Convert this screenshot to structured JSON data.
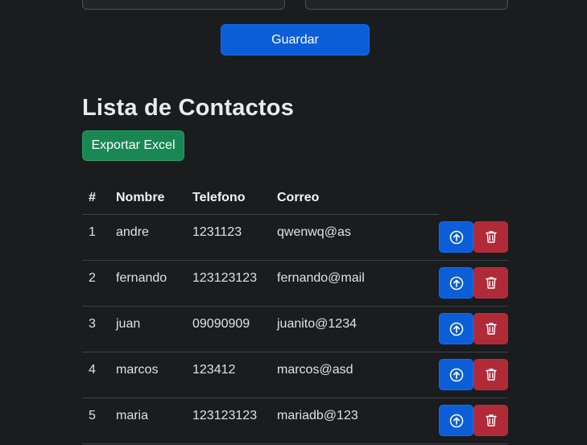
{
  "form": {
    "save_label": "Guardar"
  },
  "contacts": {
    "title": "Lista de Contactos",
    "export_label": "Exportar Excel",
    "columns": {
      "num": "#",
      "name": "Nombre",
      "phone": "Telefono",
      "email": "Correo"
    },
    "rows": [
      {
        "num": "1",
        "name": "andre",
        "phone": "1231123",
        "email": "qwenwq@as"
      },
      {
        "num": "2",
        "name": "fernando",
        "phone": "123123123",
        "email": "fernando@mail"
      },
      {
        "num": "3",
        "name": "juan",
        "phone": "09090909",
        "email": "juanito@1234"
      },
      {
        "num": "4",
        "name": "marcos",
        "phone": "123412",
        "email": "marcos@asd"
      },
      {
        "num": "5",
        "name": "maria",
        "phone": "123123123",
        "email": "mariadb@123"
      }
    ]
  },
  "icons": {
    "edit": "arrow-up-circle-icon",
    "delete": "trash-icon"
  },
  "colors": {
    "background": "#1b1c1e",
    "primary": "#0b5ed7",
    "success": "#198754",
    "danger": "#b02a37"
  }
}
